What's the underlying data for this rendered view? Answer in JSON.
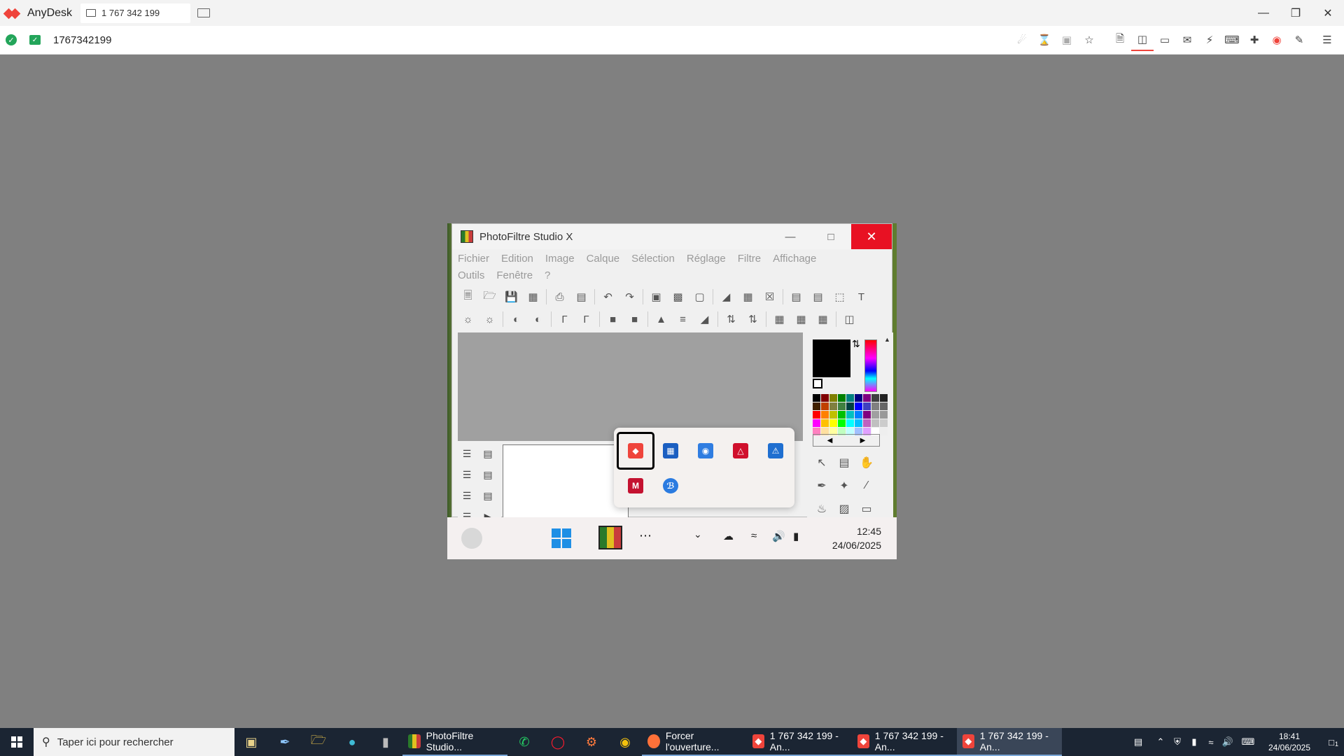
{
  "anydesk": {
    "app_name": "AnyDesk",
    "tab_label": "1 767 342 199",
    "address": "1767342199"
  },
  "remote": {
    "photofiltre": {
      "title": "PhotoFiltre Studio X",
      "menus": [
        "Fichier",
        "Edition",
        "Image",
        "Calque",
        "Sélection",
        "Réglage",
        "Filtre",
        "Affichage",
        "Outils",
        "Fenêtre",
        "?"
      ]
    },
    "taskbar": {
      "time": "12:45",
      "date": "24/06/2025"
    }
  },
  "taskbar": {
    "search_placeholder": "Taper ici pour rechercher",
    "apps": [
      {
        "label": "PhotoFiltre Studio..."
      },
      {
        "label": "Forcer l'ouverture..."
      },
      {
        "label": "1 767 342 199 - An..."
      },
      {
        "label": "1 767 342 199 - An..."
      },
      {
        "label": "1 767 342 199 - An..."
      }
    ],
    "time": "18:41",
    "date": "24/06/2025",
    "notification_count": "1"
  },
  "colors": {
    "anydesk_red": "#ef443b",
    "close_red": "#e81123",
    "taskbar_bg": "#1b2533"
  }
}
